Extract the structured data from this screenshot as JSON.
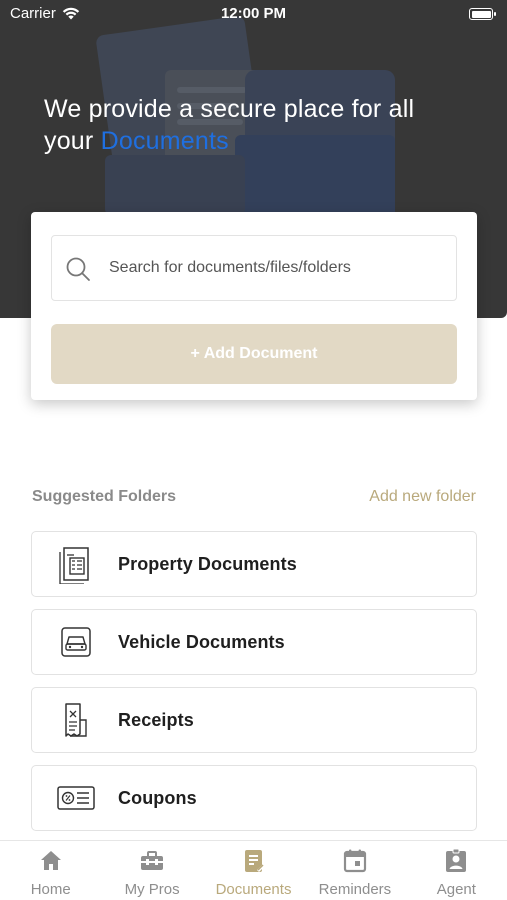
{
  "status_bar": {
    "carrier": "Carrier",
    "time": "12:00 PM",
    "icons": [
      "wifi-icon",
      "battery-icon"
    ]
  },
  "hero": {
    "title_prefix": "We provide a secure place for all your ",
    "title_highlight": "Documents",
    "highlight_color": "#1f6fe0",
    "background_color": "#373737"
  },
  "search": {
    "placeholder": "Search for documents/files/folders",
    "icon": "search-icon"
  },
  "add_document_button": {
    "label": "+ Add Document",
    "color": "#e2d9c5"
  },
  "suggested": {
    "title": "Suggested Folders",
    "add_link": "Add new folder",
    "accent_color": "#b9a97c",
    "folders": [
      {
        "label": "Property Documents",
        "icon": "building-document-icon"
      },
      {
        "label": "Vehicle Documents",
        "icon": "car-icon"
      },
      {
        "label": "Receipts",
        "icon": "receipt-icon"
      },
      {
        "label": "Coupons",
        "icon": "coupon-icon"
      }
    ]
  },
  "tab_bar": {
    "active": "Documents",
    "tabs": [
      {
        "label": "Home",
        "icon": "home-icon"
      },
      {
        "label": "My Pros",
        "icon": "toolbox-icon"
      },
      {
        "label": "Documents",
        "icon": "document-edit-icon"
      },
      {
        "label": "Reminders",
        "icon": "calendar-icon"
      },
      {
        "label": "Agent",
        "icon": "agent-badge-icon"
      }
    ]
  }
}
